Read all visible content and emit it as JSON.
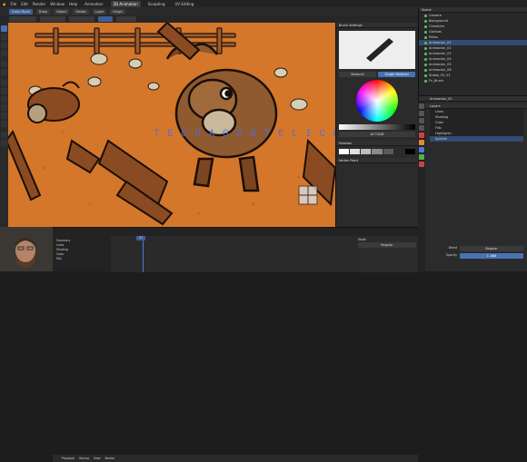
{
  "menubar": {
    "items": [
      "File",
      "Edit",
      "Render",
      "Window",
      "Help"
    ],
    "workspaces": [
      "Animation",
      "2D Animation",
      "Sculpting",
      "UV Editing"
    ],
    "active_workspace": "2D Animation"
  },
  "header": {
    "mode": "Draw Mode",
    "chips": [
      "Draw",
      "Object",
      "Stroke",
      "Layer",
      "Origin"
    ]
  },
  "properties_panel": {
    "brush_panel_title": "Brush Settings",
    "tabs": [
      "Material",
      "Single Material"
    ],
    "palette_label": "Palettes",
    "swatches": [
      "#ffffff",
      "#e0e0e0",
      "#bdbdbd",
      "#8a8a8a",
      "#5a5a5a",
      "#2a2a2a",
      "#000000"
    ],
    "color_hex": "#C77A2B",
    "vertex_paint_label": "Vertex Paint"
  },
  "outliner": {
    "title": "Scene",
    "items": [
      "Camera",
      "Background",
      "Character",
      "Gallinas",
      "Pollos",
      "Animacion_01",
      "Animacion_02",
      "Animacion_03",
      "Animacion_04",
      "Animacion_05",
      "Animacion_06",
      "Stroke_FX_01",
      "Fx_Brush"
    ],
    "selected_index": 5
  },
  "properties_editor": {
    "object_name": "Animacion_01",
    "layer_label": "Layers",
    "layer_items": [
      "Lines",
      "Shading",
      "Color",
      "Fills",
      "Highlights",
      "Sparkle"
    ],
    "mode_label": "Mode",
    "mode_value": "Regular",
    "blend_label": "Blend",
    "blend_value": "Regular",
    "opacity_label": "Opacity",
    "opacity_value": "1.000"
  },
  "timeline": {
    "tracks": [
      "Summary",
      "Lines",
      "Shading",
      "Color",
      "Fills"
    ],
    "current_frame": "37",
    "menu": [
      "Playback",
      "Keying",
      "View",
      "Marker"
    ]
  },
  "viewport": {
    "watermark": "T E C H  A G E N T  C L I C K  B A N K"
  }
}
